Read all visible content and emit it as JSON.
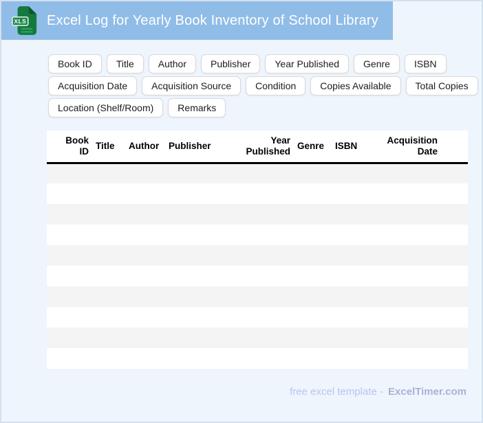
{
  "header": {
    "title": "Excel Log for Yearly Book Inventory of School Library",
    "file_icon_label": "XLS"
  },
  "chips": {
    "row1": [
      "Book ID",
      "Title",
      "Author",
      "Publisher",
      "Year Published",
      "Genre",
      "ISBN"
    ],
    "row2": [
      "Acquisition Date",
      "Acquisition Source",
      "Condition",
      "Copies Available",
      "Total Copies"
    ],
    "row3": [
      "Location (Shelf/Room)",
      "Remarks"
    ]
  },
  "table": {
    "columns": [
      {
        "label": "Book ID",
        "align": "right"
      },
      {
        "label": "Title",
        "align": "left"
      },
      {
        "label": "Author",
        "align": "left"
      },
      {
        "label": "Publisher",
        "align": "left"
      },
      {
        "label": "Year Published",
        "align": "right"
      },
      {
        "label": "Genre",
        "align": "left"
      },
      {
        "label": "ISBN",
        "align": "left"
      },
      {
        "label": "Acquisition Date",
        "align": "right"
      }
    ],
    "empty_row_count": 10
  },
  "footer": {
    "prefix": "free excel template -",
    "brand": "ExcelTimer.com"
  },
  "colors": {
    "header_bar": "#90bce8",
    "page_background": "#eff5fd",
    "page_border": "#d4e0ee",
    "icon_green": "#15793f",
    "icon_fold_green": "#0a5a2c",
    "row_stripe": "#f5f4f5",
    "header_rule": "#000000",
    "footer_text": "#b6c5ee",
    "footer_brand": "#a8b2d4"
  }
}
